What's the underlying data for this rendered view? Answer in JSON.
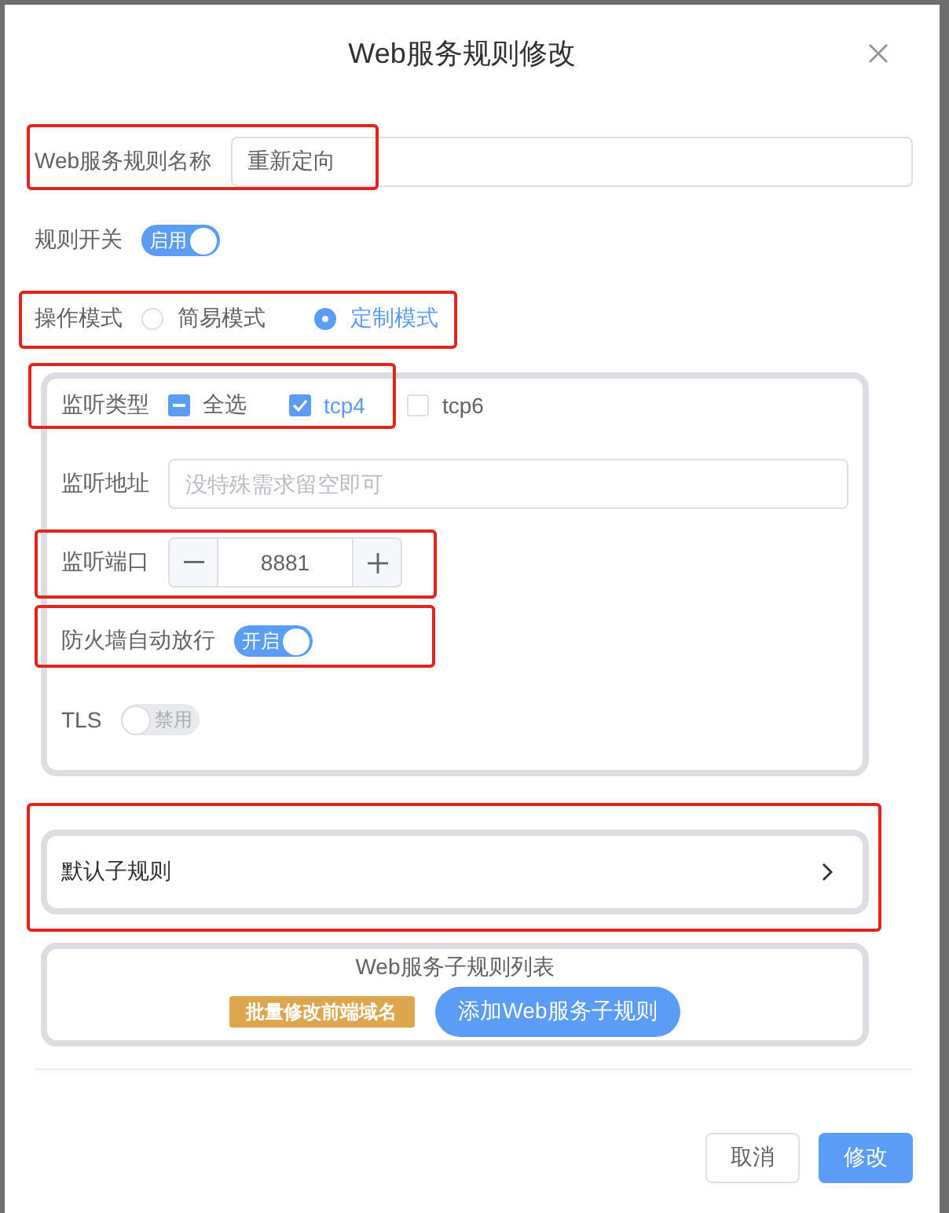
{
  "dialog": {
    "title": "Web服务规则修改"
  },
  "fields": [
    {
      "kind": "input",
      "label": "Web服务规则名称",
      "value": "重新定向",
      "highlighted": true
    },
    {
      "kind": "switch",
      "label": "规则开关",
      "on": true,
      "text": "启用",
      "highlighted": false
    },
    {
      "kind": "radio",
      "label": "操作模式",
      "options": [
        {
          "label": "简易模式",
          "selected": false
        },
        {
          "label": "定制模式",
          "selected": true
        }
      ],
      "highlighted": true
    }
  ],
  "listen_panel": {
    "fields": [
      {
        "kind": "checkboxes",
        "label": "监听类型",
        "select_all": {
          "label": "全选",
          "indeterminate": true
        },
        "options": [
          {
            "label": "tcp4",
            "checked": true
          },
          {
            "label": "tcp6",
            "checked": false
          }
        ],
        "highlighted": true
      },
      {
        "kind": "input",
        "label": "监听地址",
        "placeholder": "没特殊需求留空即可",
        "highlighted": false
      },
      {
        "kind": "number",
        "label": "监听端口",
        "value": "8881",
        "highlighted": true
      },
      {
        "kind": "switch",
        "label": "防火墙自动放行",
        "on": true,
        "text": "开启",
        "highlighted": true
      },
      {
        "kind": "switch",
        "label": "TLS",
        "on": false,
        "text": "禁用",
        "highlighted": false
      }
    ]
  },
  "default_subrule": {
    "label": "默认子规则",
    "highlighted": true
  },
  "subrule_list": {
    "title": "Web服务子规则列表",
    "buttons": [
      {
        "label": "批量修改前端域名",
        "kind": "warning"
      },
      {
        "label": "添加Web服务子规则",
        "kind": "primary"
      }
    ]
  },
  "footer": {
    "buttons": [
      {
        "label": "取消",
        "kind": "default"
      },
      {
        "label": "修改",
        "kind": "primary"
      }
    ]
  }
}
